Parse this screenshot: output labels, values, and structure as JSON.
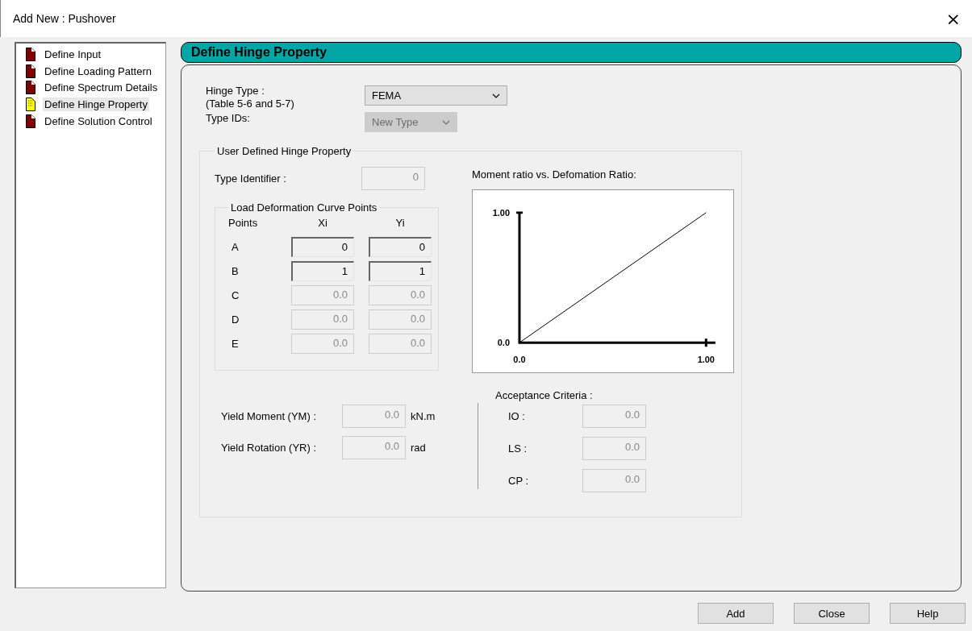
{
  "window": {
    "title": "Add New : Pushover",
    "close": "×"
  },
  "sidebar": {
    "items": [
      {
        "label": "Define Input",
        "selected": false
      },
      {
        "label": "Define Loading Pattern",
        "selected": false
      },
      {
        "label": "Define Spectrum Details",
        "selected": false
      },
      {
        "label": "Define Hinge Property",
        "selected": true
      },
      {
        "label": "Define Solution Control",
        "selected": false
      }
    ]
  },
  "panel": {
    "title": "Define Hinge Property",
    "hinge_type": {
      "label": "Hinge Type :",
      "sublabel": "(Table 5-6 and 5-7)",
      "value": "FEMA",
      "disabled": false
    },
    "type_ids": {
      "label": "Type IDs:",
      "value": "New Type",
      "disabled": true
    },
    "user_defined": {
      "title": "User Defined Hinge Property",
      "type_identifier": {
        "label": "Type Identifier :",
        "value": "0",
        "disabled": true
      },
      "curve_points": {
        "title": "Load Deformation Curve Points",
        "columns": [
          "Points",
          "Xi",
          "Yi"
        ],
        "rows": [
          {
            "point": "A",
            "xi": "0",
            "yi": "0",
            "disabled": false
          },
          {
            "point": "B",
            "xi": "1",
            "yi": "1",
            "disabled": false
          },
          {
            "point": "C",
            "xi": "0.0",
            "yi": "0.0",
            "disabled": true
          },
          {
            "point": "D",
            "xi": "0.0",
            "yi": "0.0",
            "disabled": true
          },
          {
            "point": "E",
            "xi": "0.0",
            "yi": "0.0",
            "disabled": true
          }
        ]
      },
      "chart_data": {
        "type": "line",
        "title": "Moment ratio vs. Defomation Ratio:",
        "x": [
          0,
          1
        ],
        "values": [
          0,
          1
        ],
        "xlim": [
          0,
          1.05
        ],
        "ylim": [
          0,
          1
        ],
        "xticks": [
          {
            "value": 0,
            "label": "0.0"
          },
          {
            "value": 1,
            "label": "1.00"
          }
        ],
        "yticks": [
          {
            "value": 0,
            "label": "0.0"
          },
          {
            "value": 1,
            "label": "1.00"
          }
        ]
      },
      "yield": [
        {
          "label": "Yield Moment (YM) :",
          "value": "0.0",
          "unit": "kN.m",
          "disabled": true
        },
        {
          "label": "Yield Rotation (YR) :",
          "value": "0.0",
          "unit": "rad",
          "disabled": true
        }
      ],
      "acceptance": {
        "title": "Acceptance Criteria :",
        "items": [
          {
            "label": "IO :",
            "value": "0.0",
            "disabled": true
          },
          {
            "label": "LS :",
            "value": "0.0",
            "disabled": true
          },
          {
            "label": "CP :",
            "value": "0.0",
            "disabled": true
          }
        ]
      }
    }
  },
  "buttons": [
    "Add",
    "Close",
    "Help"
  ]
}
